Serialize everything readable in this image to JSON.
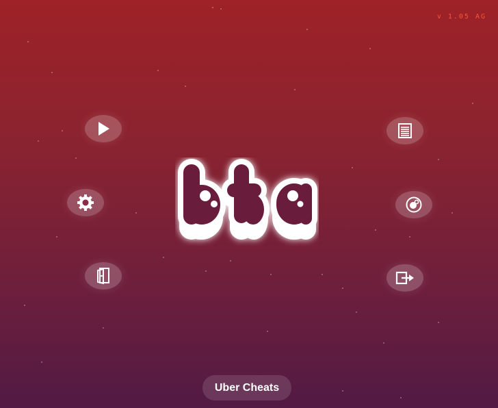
{
  "version_label": "v 1.05 AG",
  "logo_text": "bta",
  "menu": {
    "left": [
      {
        "icon": "play-icon"
      },
      {
        "icon": "gear-icon"
      },
      {
        "icon": "door-icon"
      }
    ],
    "right": [
      {
        "icon": "list-icon"
      },
      {
        "icon": "ball-icon"
      },
      {
        "icon": "exit-icon"
      }
    ]
  },
  "bottom_button": {
    "label": "Uber Cheats"
  },
  "colors": {
    "background_top": "#9e2227",
    "background_bottom": "#521a44",
    "version_text": "#f0583c",
    "logo_fill": "#6b1d3c",
    "logo_outline": "#ffffff"
  }
}
